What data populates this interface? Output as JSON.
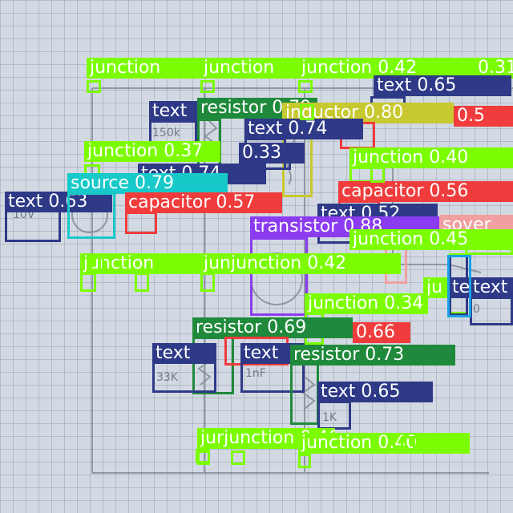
{
  "colors": {
    "junction": "#7cfc00",
    "text": "#2e3a87",
    "resistor": "#1f8a3b",
    "inductor": "#c8c830",
    "capacitor": "#f03c3c",
    "source": "#17c9c9",
    "transistor": "#8b3cf0",
    "crossover": "#f0a0a0",
    "unlabeled": "#1aa0e6"
  },
  "detections": [
    {
      "cls": "junction",
      "label": "junction"
    },
    {
      "cls": "junction",
      "label": "junction"
    },
    {
      "cls": "junction",
      "label": "junction 0.42"
    },
    {
      "cls": "junction",
      "label": "0.31"
    },
    {
      "cls": "text",
      "label": "text 0.65"
    },
    {
      "cls": "text",
      "label": "text"
    },
    {
      "cls": "resistor",
      "label": "resistor 0.79"
    },
    {
      "cls": "inductor",
      "label": "inductor 0.80"
    },
    {
      "cls": "capacitor",
      "label": "0.5"
    },
    {
      "cls": "text",
      "label": "text 0.74"
    },
    {
      "cls": "junction",
      "label": "junction 0.37"
    },
    {
      "cls": "text",
      "label": "0.33"
    },
    {
      "cls": "junction",
      "label": "junction 0.40"
    },
    {
      "cls": "text",
      "label": "text 0.74"
    },
    {
      "cls": "text",
      "label": "text 0.63"
    },
    {
      "cls": "source",
      "label": "source 0.79"
    },
    {
      "cls": "capacitor",
      "label": "capacitor 0.57"
    },
    {
      "cls": "capacitor",
      "label": "capacitor 0.56"
    },
    {
      "cls": "text",
      "label": "text 0.52"
    },
    {
      "cls": "transistor",
      "label": "transistor 0.88"
    },
    {
      "cls": "crossover",
      "label": "sover"
    },
    {
      "cls": "junction",
      "label": "junction 0.45"
    },
    {
      "cls": "junction",
      "label": "junction"
    },
    {
      "cls": "junction",
      "label": "junjunction 0.42"
    },
    {
      "cls": "junction",
      "label": "ju"
    },
    {
      "cls": "text",
      "label": "te"
    },
    {
      "cls": "text",
      "label": "text"
    },
    {
      "cls": "junction",
      "label": "junction 0.34"
    },
    {
      "cls": "resistor",
      "label": "resistor 0.69"
    },
    {
      "cls": "capacitor",
      "label": "0.66"
    },
    {
      "cls": "text",
      "label": "text"
    },
    {
      "cls": "text",
      "label": "text"
    },
    {
      "cls": "resistor",
      "label": "resistor 0.73"
    },
    {
      "cls": "text",
      "label": "text 0.65"
    },
    {
      "cls": "junction",
      "label": "jurjunction 0.46"
    },
    {
      "cls": "junction",
      "label": "junction 0.40"
    },
    {
      "cls": "junction",
      "label": ""
    },
    {
      "cls": "junction",
      "label": ""
    },
    {
      "cls": "junction",
      "label": ""
    },
    {
      "cls": "junction",
      "label": ""
    },
    {
      "cls": "junction",
      "label": ""
    },
    {
      "cls": "junction",
      "label": ""
    },
    {
      "cls": "junction",
      "label": ""
    },
    {
      "cls": "unlabeled",
      "label": ""
    }
  ]
}
